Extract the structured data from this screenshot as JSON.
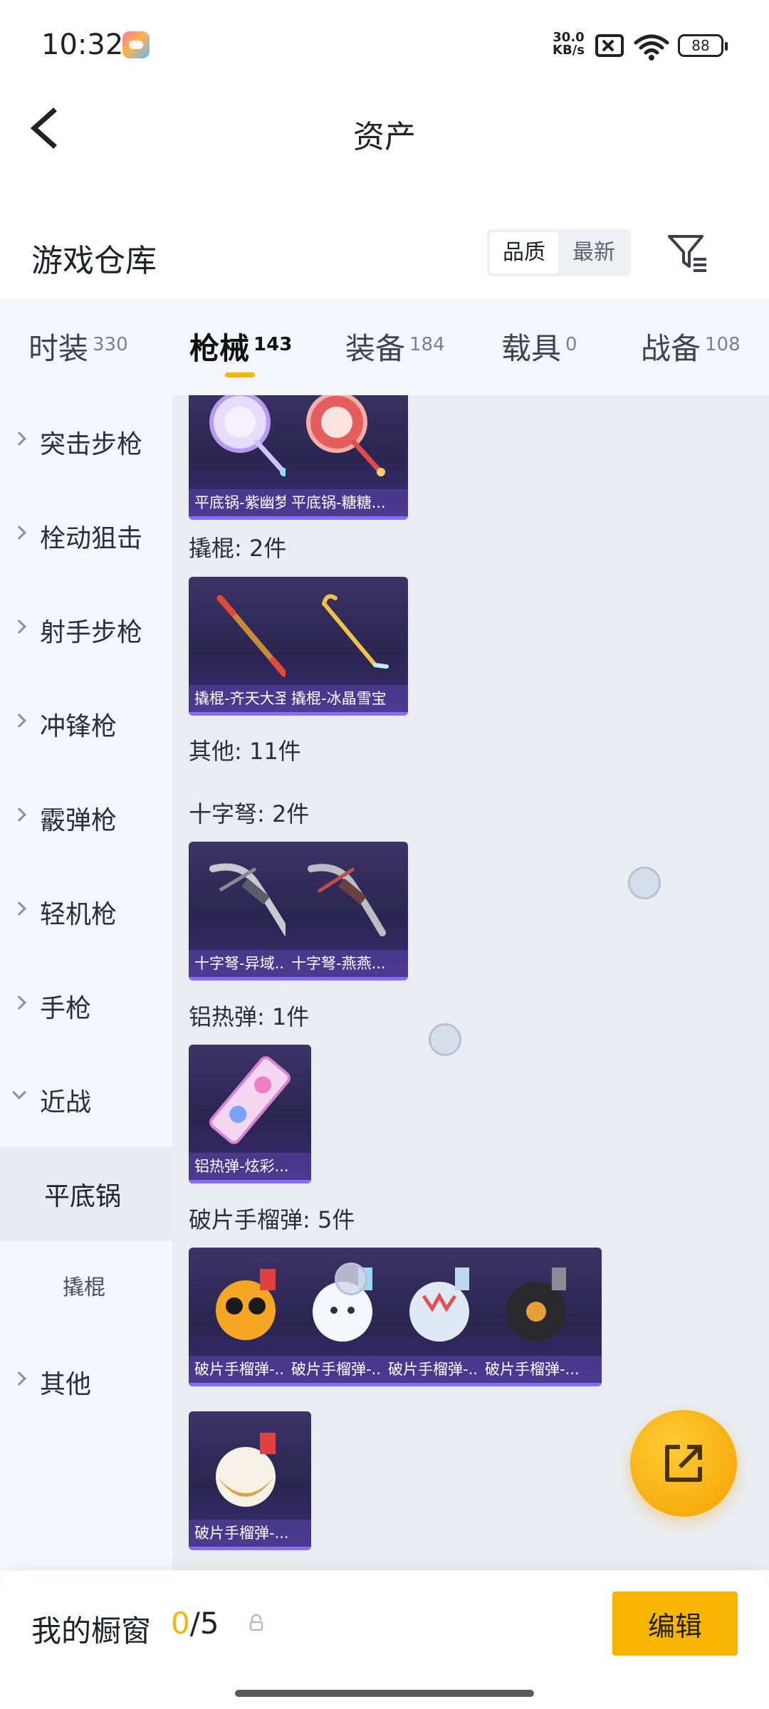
{
  "status_bar": {
    "time": "10:32",
    "net_speed_value": "30.0",
    "net_speed_unit": "KB/s",
    "battery": "88"
  },
  "header": {
    "title": "资产"
  },
  "warehouse": {
    "title": "游戏仓库",
    "sort_options": [
      "品质",
      "最新"
    ],
    "selected_sort": "品质"
  },
  "tabs": [
    {
      "label": "时装",
      "count": "330"
    },
    {
      "label": "枪械",
      "count": "143",
      "active": true
    },
    {
      "label": "装备",
      "count": "184"
    },
    {
      "label": "载具",
      "count": "0"
    },
    {
      "label": "战备",
      "count": "108"
    }
  ],
  "sidebar": {
    "items": [
      {
        "label": "突击步枪",
        "expanded": false
      },
      {
        "label": "栓动狙击",
        "expanded": false
      },
      {
        "label": "射手步枪",
        "expanded": false
      },
      {
        "label": "冲锋枪",
        "expanded": false
      },
      {
        "label": "霰弹枪",
        "expanded": false
      },
      {
        "label": "轻机枪",
        "expanded": false
      },
      {
        "label": "手枪",
        "expanded": false
      },
      {
        "label": "近战",
        "expanded": true
      },
      {
        "label": "平底锅",
        "selected": true
      },
      {
        "label": "撬棍"
      },
      {
        "label": "其他",
        "expanded": false
      }
    ]
  },
  "content": {
    "top_items": [
      "平底锅-紫幽梦",
      "平底锅-糖糖..."
    ],
    "crowbar": {
      "title": "撬棍: 2件",
      "items": [
        "撬棍-齐天大圣",
        "撬棍-冰晶雪宝"
      ]
    },
    "other_title": "其他: 11件",
    "crossbow": {
      "title": "十字弩: 2件",
      "items": [
        "十字弩-异域...",
        "十字弩-燕燕..."
      ]
    },
    "thermite": {
      "title": "铝热弹: 1件",
      "items": [
        "铝热弹-炫彩..."
      ]
    },
    "grenade": {
      "title": "破片手榴弹: 5件",
      "items": [
        "破片手榴弹-...",
        "破片手榴弹-...",
        "破片手榴弹-...",
        "破片手榴弹-...",
        "破片手榴弹-..."
      ]
    }
  },
  "bottom_bar": {
    "showcase_label": "我的橱窗",
    "showcase_current": "0",
    "showcase_sep": "/",
    "showcase_max": "5",
    "edit_label": "编辑"
  },
  "colors": {
    "accent": "#f7b500",
    "card_bg": "#2b2550",
    "card_border": "#8b6cf5",
    "panel_bg": "#e9edf2",
    "sidebar_bg": "#f3f6fa"
  }
}
